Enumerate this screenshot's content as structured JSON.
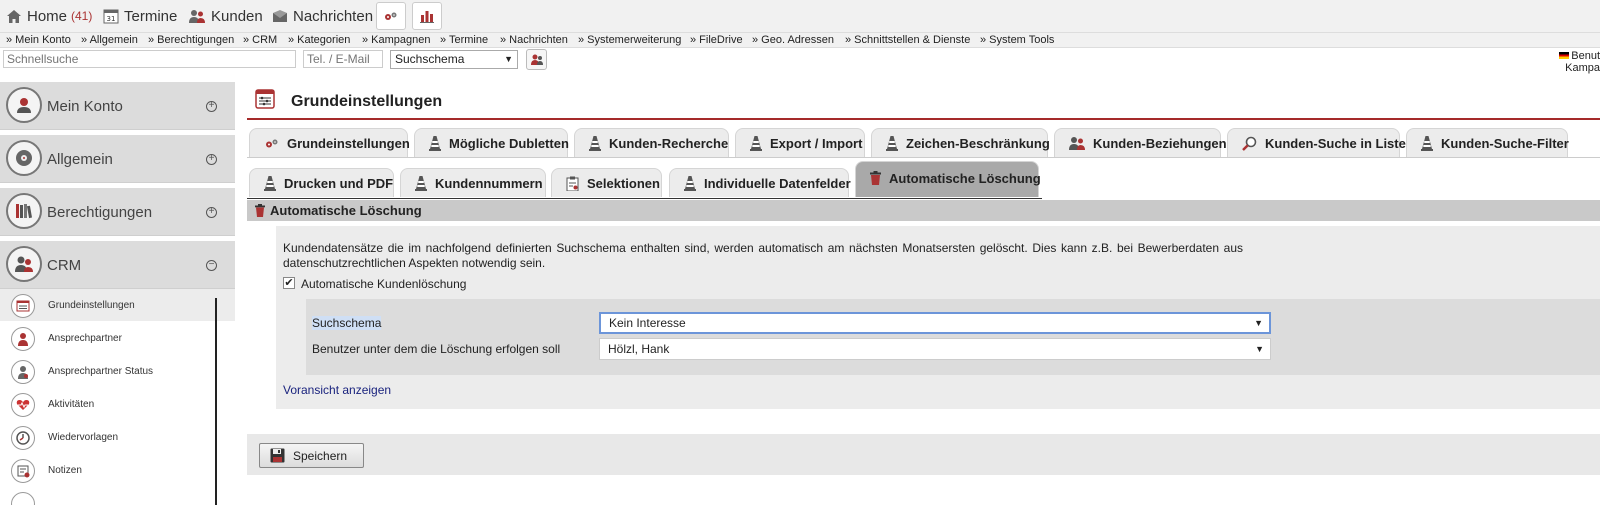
{
  "topnav": {
    "home_label": "Home",
    "home_count": "(41)",
    "termine_label": "Termine",
    "kunden_label": "Kunden",
    "nachrichten_label": "Nachrichten"
  },
  "menubar": [
    "» Mein Konto",
    "» Allgemein",
    "» Berechtigungen",
    "» CRM",
    "» Kategorien",
    "» Kampagnen",
    "» Termine",
    "» Nachrichten",
    "» Systemerweiterung",
    "» FileDrive",
    "» Geo. Adressen",
    "» Schnittstellen & Dienste",
    "» System Tools"
  ],
  "search": {
    "quick_placeholder": "Schnellsuche",
    "phone_placeholder": "Tel. / E-Mail",
    "schema_value": "Suchschema",
    "right_line1": "Benut",
    "right_line2": "Kampa"
  },
  "sidebar": {
    "groups": [
      {
        "label": "Mein Konto",
        "toggle": "+"
      },
      {
        "label": "Allgemein",
        "toggle": "+"
      },
      {
        "label": "Berechtigungen",
        "toggle": "+"
      },
      {
        "label": "CRM",
        "toggle": "−"
      }
    ],
    "items": [
      {
        "label": "Grundeinstellungen"
      },
      {
        "label": "Ansprechpartner"
      },
      {
        "label": "Ansprechpartner Status"
      },
      {
        "label": "Aktivitäten"
      },
      {
        "label": "Wiedervorlagen"
      },
      {
        "label": "Notizen"
      }
    ]
  },
  "page": {
    "title": "Grundeinstellungen",
    "tabs_row1": [
      "Grundeinstellungen",
      "Mögliche Dubletten",
      "Kunden-Recherche",
      "Export / Import",
      "Zeichen-Beschränkung",
      "Kunden-Beziehungen",
      "Kunden-Suche in Liste",
      "Kunden-Suche-Filter"
    ],
    "tabs_row2": [
      "Drucken und PDF",
      "Kundennummern",
      "Selektionen",
      "Individuelle Datenfelder",
      "Automatische Löschung"
    ],
    "section_title": "Automatische Löschung",
    "description": "Kundendatensätze die im nachfolgend definierten Suchschema enthalten sind, werden automatisch am nächsten Monatsersten gelöscht. Dies kann z.B. bei Bewerberdaten aus datenschutzrechtlichen Aspekten notwendig sein.",
    "checkbox_label": "Automatische Kundenlöschung",
    "checkbox_checked": true,
    "field1_label": "Suchschema",
    "field1_value": "Kein Interesse",
    "field2_label": "Benutzer unter dem die Löschung erfolgen soll",
    "field2_value": "Hölzl, Hank",
    "preview_link": "Voransicht anzeigen",
    "save_label": "Speichern"
  },
  "colors": {
    "accent": "#a52a2a",
    "tab_active": "#a9a9a9",
    "link": "#1a237e"
  }
}
